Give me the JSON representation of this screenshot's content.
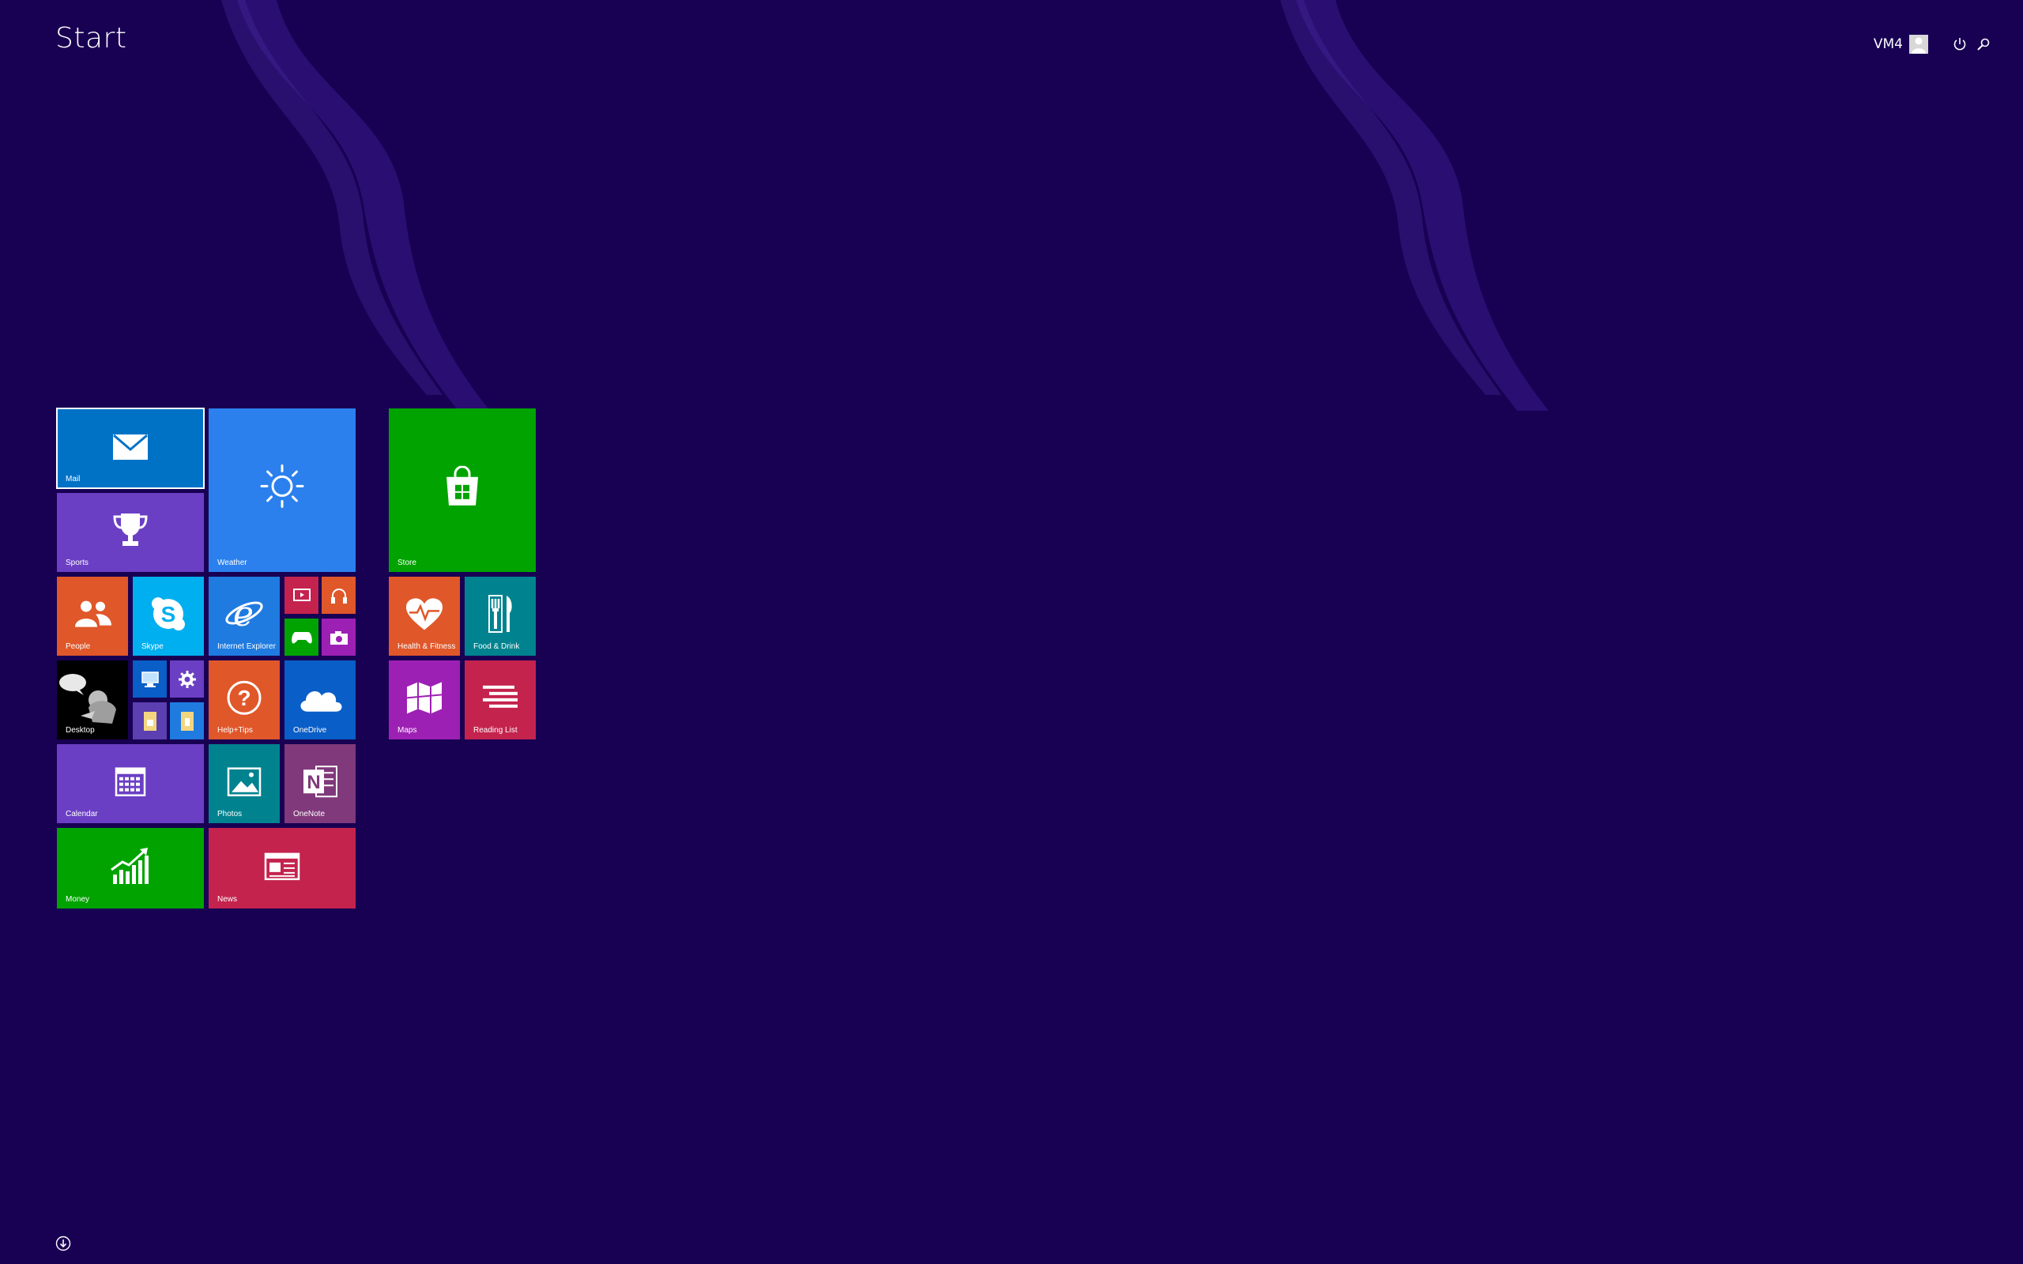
{
  "header": {
    "title": "Start"
  },
  "user": {
    "name": "VM4"
  },
  "tiles": {
    "mail": {
      "label": "Mail",
      "color": "#0072c6"
    },
    "weather": {
      "label": "Weather",
      "color": "#2b80ee"
    },
    "store": {
      "label": "Store",
      "color": "#00a300"
    },
    "sports": {
      "label": "Sports",
      "color": "#6b3fc4"
    },
    "people": {
      "label": "People",
      "color": "#e0572a"
    },
    "skype": {
      "label": "Skype",
      "color": "#00aff0"
    },
    "internet_explorer": {
      "label": "Internet Explorer",
      "color": "#1f7be0"
    },
    "health": {
      "label": "Health & Fitness",
      "color": "#e0572a"
    },
    "food": {
      "label": "Food & Drink",
      "color": "#00838f"
    },
    "desktop": {
      "label": "Desktop",
      "color": "#000000"
    },
    "help": {
      "label": "Help+Tips",
      "color": "#e0572a"
    },
    "onedrive": {
      "label": "OneDrive",
      "color": "#0a5ec7"
    },
    "maps": {
      "label": "Maps",
      "color": "#9d20b4"
    },
    "reading_list": {
      "label": "Reading List",
      "color": "#c4234e"
    },
    "calendar": {
      "label": "Calendar",
      "color": "#6b3fc4"
    },
    "photos": {
      "label": "Photos",
      "color": "#00838f"
    },
    "onenote": {
      "label": "OneNote",
      "color": "#80397b"
    },
    "money": {
      "label": "Money",
      "color": "#00a300"
    },
    "news": {
      "label": "News",
      "color": "#c4234e"
    }
  }
}
